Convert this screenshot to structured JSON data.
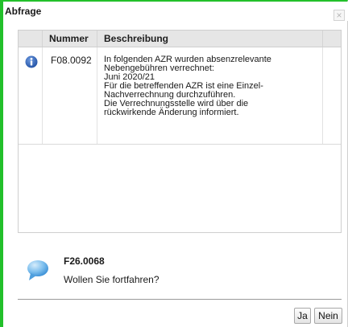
{
  "window": {
    "title": "Abfrage",
    "close_glyph": "×"
  },
  "table": {
    "columns": [
      "",
      "Nummer",
      "Beschreibung",
      ""
    ],
    "rows": [
      {
        "icon": "info-icon",
        "number": "F08.0092",
        "description_lines": [
          "In folgenden AZR wurden absenzrelevante",
          "Nebengebühren verrechnet:",
          "Juni 2020/21",
          "Für die betreffenden AZR ist eine Einzel-",
          "Nachverrechnung durchzuführen.",
          "Die Verrechnungsstelle wird über die",
          "rückwirkende Änderung informiert."
        ]
      }
    ]
  },
  "message": {
    "icon": "speech-bubble-icon",
    "code": "F26.0068",
    "text": "Wollen Sie fortfahren?"
  },
  "buttons": {
    "yes_label": "Ja",
    "no_label": "Nein"
  },
  "colors": {
    "accent_border": "#22c02a",
    "header_bg": "#e6e6e6",
    "info_icon": "#1f4fa3",
    "bubble_icon": "#5aa8e6"
  }
}
